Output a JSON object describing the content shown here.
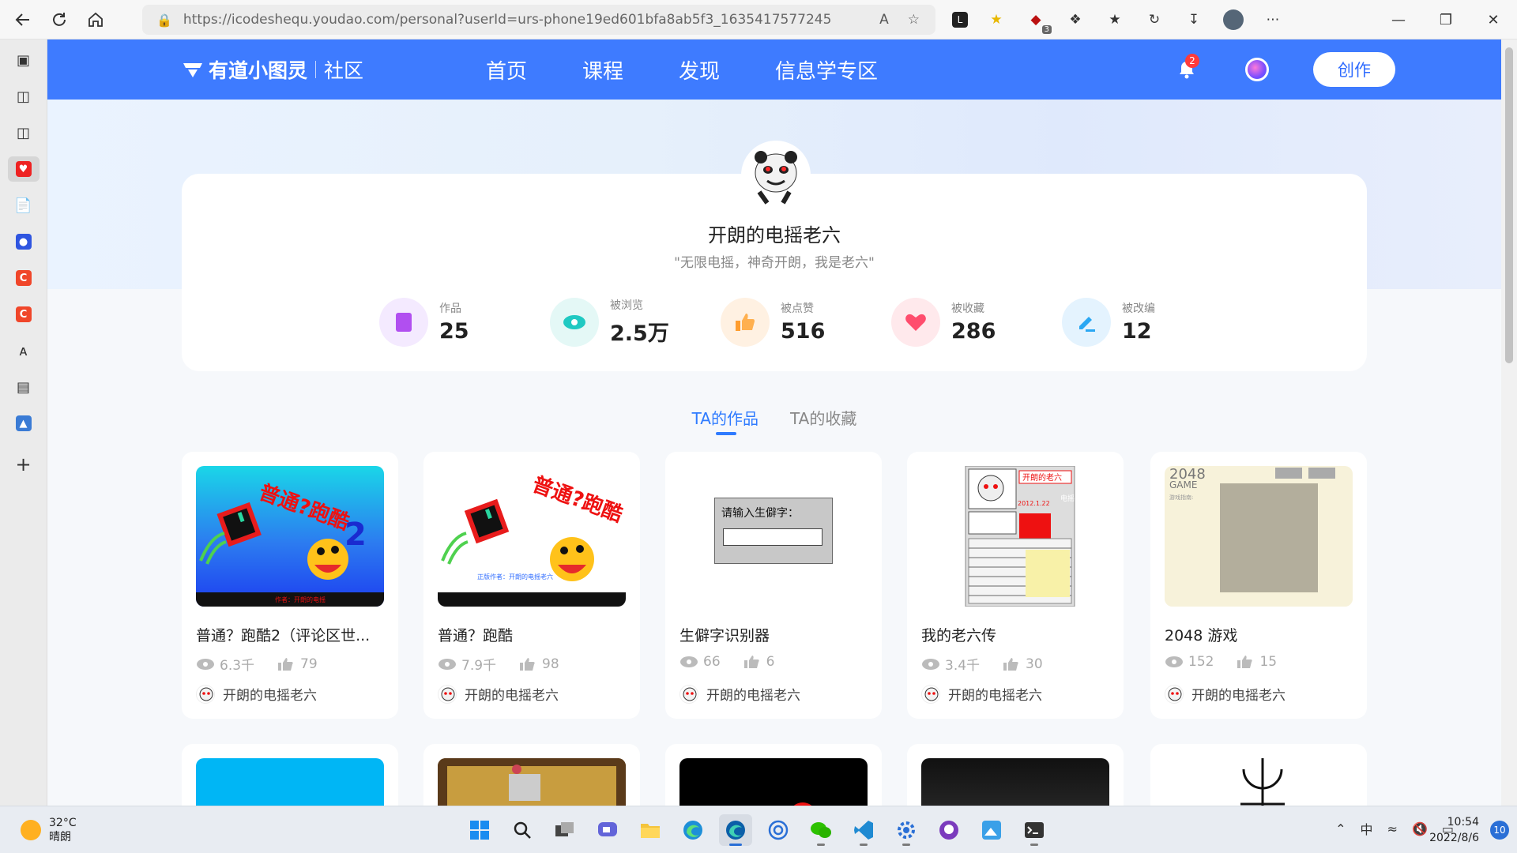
{
  "browser": {
    "url": "https://icodeshequ.youdao.com/personal?userId=urs-phone19ed601bfa8ab5f3_1635417577245",
    "ublock_count": "3"
  },
  "site": {
    "logo_text": "有道小图灵",
    "logo_sub": "社区",
    "nav": [
      "首页",
      "课程",
      "发现",
      "信息学专区"
    ],
    "notification_count": "2",
    "create_label": "创作"
  },
  "profile": {
    "name": "开朗的电摇老六",
    "motto": "\"无限电摇，神奇开朗，我是老六\"",
    "stats": [
      {
        "label": "作品",
        "value": "25",
        "color": "#b14ff0",
        "bg": "#f4eaff",
        "icon": "works-icon"
      },
      {
        "label": "被浏览",
        "value": "2.5万",
        "color": "#20c9c2",
        "bg": "#e4f8f6",
        "icon": "eye-icon"
      },
      {
        "label": "被点赞",
        "value": "516",
        "color": "#ff9d2e",
        "bg": "#fff1e2",
        "icon": "thumb-icon"
      },
      {
        "label": "被收藏",
        "value": "286",
        "color": "#ff4d6d",
        "bg": "#ffe9ec",
        "icon": "heart-icon"
      },
      {
        "label": "被改编",
        "value": "12",
        "color": "#2aa7f3",
        "bg": "#e4f3fe",
        "icon": "edit-icon"
      }
    ]
  },
  "tabs": [
    "TA的作品",
    "TA的收藏"
  ],
  "works": [
    {
      "title": "普通？跑酷2（评论区世...",
      "views": "6.3千",
      "likes": "79",
      "author": "开朗的电摇老六",
      "thumb_text": "普通?跑酷",
      "thumb_text2": "2",
      "credit": "作者：开朗的电摇"
    },
    {
      "title": "普通？跑酷",
      "views": "7.9千",
      "likes": "98",
      "author": "开朗的电摇老六",
      "thumb_text": "普通?跑酷",
      "credit": "正版作者：开朗的电摇老六"
    },
    {
      "title": "生僻字识别器",
      "views": "66",
      "likes": "6",
      "author": "开朗的电摇老六",
      "thumb_text": "请输入生僻字："
    },
    {
      "title": "我的老六传",
      "views": "3.4千",
      "likes": "30",
      "author": "开朗的电摇老六",
      "thumb_text": "开朗的老六",
      "thumb_text2": "2012.1.22",
      "thumb_text3": "电摇"
    },
    {
      "title": "2048 游戏",
      "views": "152",
      "likes": "15",
      "author": "开朗的电摇老六",
      "thumb_text": "2048",
      "thumb_text2": "GAME",
      "thumb_text3": "游戏指南:"
    }
  ],
  "taskbar": {
    "temperature": "32°C",
    "weather": "晴朗",
    "ime": "中",
    "time": "10:54",
    "date": "2022/8/6",
    "notifications": "10"
  }
}
